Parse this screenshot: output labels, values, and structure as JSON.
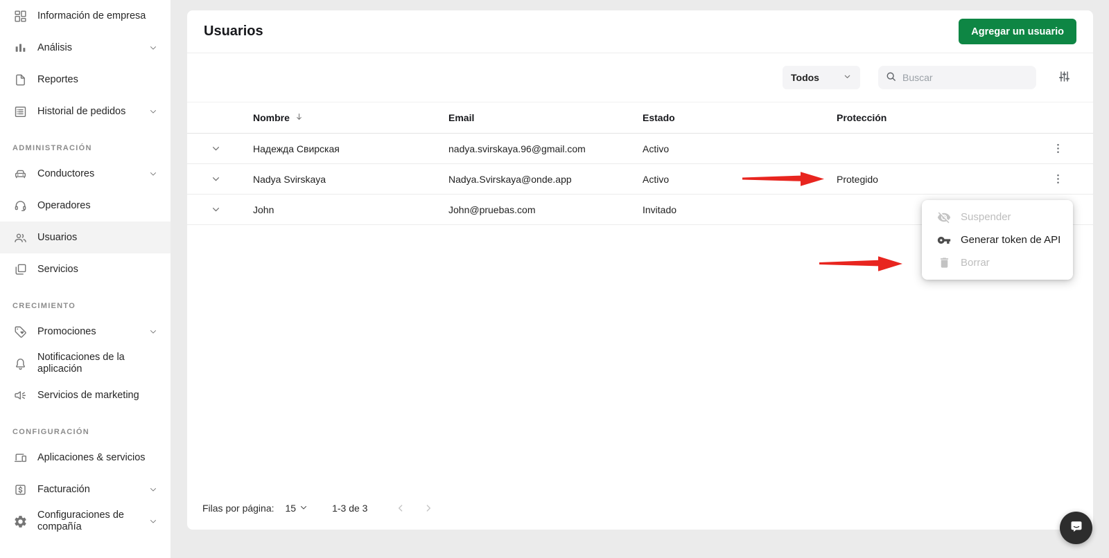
{
  "sidebar": {
    "sections": [
      {
        "title": "",
        "items": [
          {
            "label": "Información de empresa",
            "icon": "company-info-icon",
            "chevron": false,
            "selected": false
          },
          {
            "label": "Análisis",
            "icon": "analytics-icon",
            "chevron": true,
            "selected": false
          },
          {
            "label": "Reportes",
            "icon": "reports-icon",
            "chevron": false,
            "selected": false
          },
          {
            "label": "Historial de pedidos",
            "icon": "order-history-icon",
            "chevron": true,
            "selected": false
          }
        ]
      },
      {
        "title": "ADMINISTRACIÓN",
        "items": [
          {
            "label": "Conductores",
            "icon": "drivers-icon",
            "chevron": true,
            "selected": false
          },
          {
            "label": "Operadores",
            "icon": "operators-icon",
            "chevron": false,
            "selected": false
          },
          {
            "label": "Usuarios",
            "icon": "users-icon",
            "chevron": false,
            "selected": true
          },
          {
            "label": "Servicios",
            "icon": "services-icon",
            "chevron": false,
            "selected": false
          }
        ]
      },
      {
        "title": "CRECIMIENTO",
        "items": [
          {
            "label": "Promociones",
            "icon": "promotions-icon",
            "chevron": true,
            "selected": false
          },
          {
            "label": "Notificaciones de la aplicación",
            "icon": "app-notifications-icon",
            "chevron": false,
            "selected": false
          },
          {
            "label": "Servicios de marketing",
            "icon": "marketing-icon",
            "chevron": false,
            "selected": false
          }
        ]
      },
      {
        "title": "CONFIGURACIÓN",
        "items": [
          {
            "label": "Aplicaciones & servicios",
            "icon": "apps-services-icon",
            "chevron": false,
            "selected": false
          },
          {
            "label": "Facturación",
            "icon": "billing-icon",
            "chevron": true,
            "selected": false
          },
          {
            "label": "Configuraciones de compañía",
            "icon": "company-settings-icon",
            "chevron": true,
            "selected": false
          }
        ]
      }
    ]
  },
  "header": {
    "title": "Usuarios",
    "add_user_button": "Agregar un usuario"
  },
  "filters": {
    "type_filter_value": "Todos",
    "search_placeholder": "Buscar"
  },
  "table": {
    "columns": {
      "name": "Nombre",
      "email": "Email",
      "status": "Estado",
      "protection": "Protección"
    },
    "sorted_column": "Nombre",
    "rows": [
      {
        "name": "Надежда Свирская",
        "email": "nadya.svirskaya.96@gmail.com",
        "status": "Activo",
        "protection": ""
      },
      {
        "name": "Nadya Svirskaya",
        "email": "Nadya.Svirskaya@onde.app",
        "status": "Activo",
        "protection": "Protegido"
      },
      {
        "name": "John",
        "email": "John@pruebas.com",
        "status": "Invitado",
        "protection": ""
      }
    ]
  },
  "context_menu": {
    "items": [
      {
        "label": "Suspender",
        "icon": "eye-off-icon",
        "disabled": true
      },
      {
        "label": "Generar token de API",
        "icon": "key-icon",
        "disabled": false
      },
      {
        "label": "Borrar",
        "icon": "trash-icon",
        "disabled": true
      }
    ]
  },
  "pagination": {
    "rows_per_page_label": "Filas por página:",
    "rows_per_page_value": "15",
    "range_label": "1-3 de 3"
  },
  "annotations": {
    "arrow_1_target": "Protegido",
    "arrow_2_target": "Borrar"
  },
  "colors": {
    "accent_green": "#0e8644",
    "arrow_red": "#e8251f",
    "selected_nav_bg": "#f3f3f3",
    "page_bg": "#ebebeb"
  }
}
